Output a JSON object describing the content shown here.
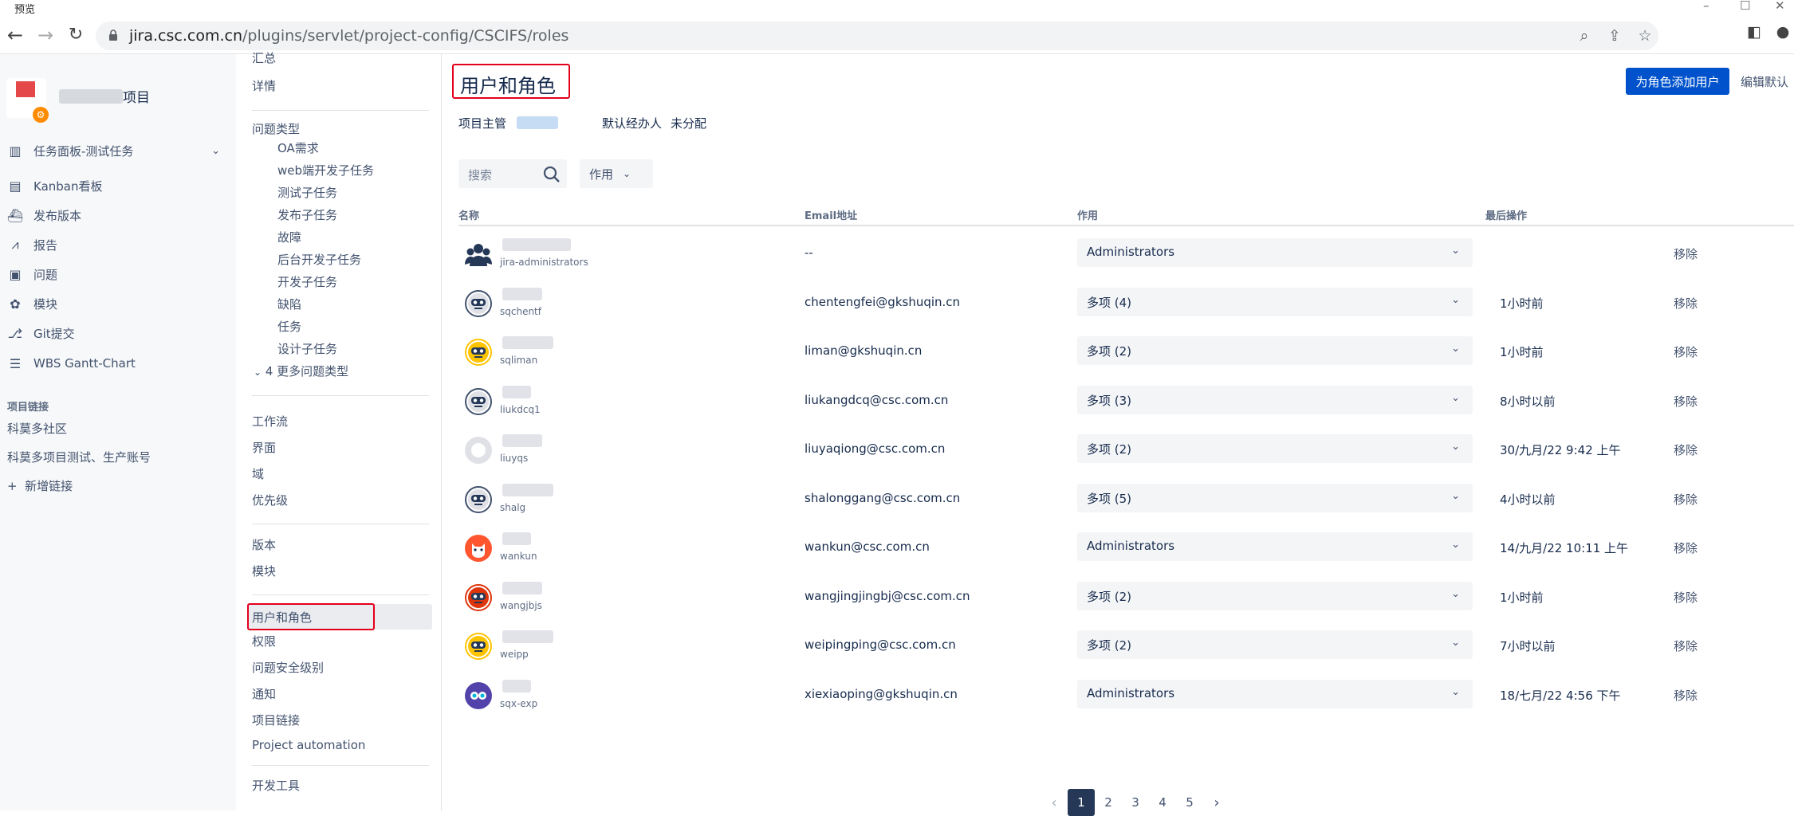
{
  "window": {
    "title": "预览"
  },
  "browser": {
    "url_host": "jira.csc.com.cn",
    "url_path": "/plugins/servlet/project-config/CSCIFS/roles"
  },
  "project_nav": {
    "project_name": "项目",
    "items": [
      {
        "label": "任务面板-测试任务",
        "icon": "board-icon",
        "has_chevron": true
      },
      {
        "label": "Kanban看板",
        "icon": "kanban-icon"
      },
      {
        "label": "发布版本",
        "icon": "ship-icon"
      },
      {
        "label": "报告",
        "icon": "chart-icon"
      },
      {
        "label": "问题",
        "icon": "issues-icon"
      },
      {
        "label": "模块",
        "icon": "puzzle-icon"
      },
      {
        "label": "Git提交",
        "icon": "git-icon"
      },
      {
        "label": "WBS Gantt-Chart",
        "icon": "gantt-icon"
      }
    ],
    "links_heading": "项目链接",
    "links": [
      "科莫多社区",
      "科莫多项目测试、生产账号"
    ],
    "add_link": "新增链接"
  },
  "settings_nav": {
    "summary": "汇总",
    "details": "详情",
    "issue_types": "问题类型",
    "issue_type_items": [
      "OA需求",
      "web端开发子任务",
      "测试子任务",
      "发布子任务",
      "故障",
      "后台开发子任务",
      "开发子任务",
      "缺陷",
      "任务",
      "设计子任务"
    ],
    "more_types": "4 更多问题类型",
    "group2": [
      "工作流",
      "界面",
      "域",
      "优先级"
    ],
    "group3": [
      "版本",
      "模块"
    ],
    "group4": [
      "用户和角色",
      "权限",
      "问题安全级别",
      "通知",
      "项目链接",
      "Project automation"
    ],
    "dev_tools": "开发工具"
  },
  "main": {
    "title": "用户和角色",
    "add_button": "为角色添加用户",
    "edit_button": "编辑默认",
    "lead_label": "项目主管",
    "assignee_label": "默认经办人",
    "assignee_value": "未分配",
    "search_placeholder": "搜索",
    "role_filter": "作用",
    "columns": {
      "name": "名称",
      "email": "Email地址",
      "role": "作用",
      "last": "最后操作"
    },
    "remove_label": "移除",
    "rows": [
      {
        "username": "jira-administrators",
        "email": "--",
        "role": "Administrators",
        "last": "",
        "avatar": "group-avatar-icon",
        "color": "#253858"
      },
      {
        "username": "sqchentf",
        "email": "chentengfei@gkshuqin.cn",
        "role": "多项 (4)",
        "last": "1小时前",
        "avatar": "robot-avatar-icon",
        "color": "#42526e"
      },
      {
        "username": "sqliman",
        "email": "liman@gkshuqin.cn",
        "role": "多项 (2)",
        "last": "1小时前",
        "avatar": "robot-avatar-icon",
        "color": "#ffc400"
      },
      {
        "username": "liukdcq1",
        "email": "liukangdcq@csc.com.cn",
        "role": "多项 (3)",
        "last": "8小时以前",
        "avatar": "robot-avatar-icon",
        "color": "#42526e"
      },
      {
        "username": "liuyqs",
        "email": "liuyaqiong@csc.com.cn",
        "role": "多项 (2)",
        "last": "30/九月/22 9:42 上午",
        "avatar": "default-avatar-icon",
        "color": "#dfe1e6"
      },
      {
        "username": "shalg",
        "email": "shalonggang@csc.com.cn",
        "role": "多项 (5)",
        "last": "4小时以前",
        "avatar": "robot-avatar-icon",
        "color": "#42526e"
      },
      {
        "username": "wankun",
        "email": "wankun@csc.com.cn",
        "role": "Administrators",
        "last": "14/九月/22 10:11 上午",
        "avatar": "fox-avatar-icon",
        "color": "#ff5630"
      },
      {
        "username": "wangjbjs",
        "email": "wangjingjingbj@csc.com.cn",
        "role": "多项 (2)",
        "last": "1小时前",
        "avatar": "robot-avatar-icon",
        "color": "#de350b"
      },
      {
        "username": "weipp",
        "email": "weipingping@csc.com.cn",
        "role": "多项 (2)",
        "last": "7小时以前",
        "avatar": "robot-avatar-icon",
        "color": "#ffc400"
      },
      {
        "username": "sqx-exp",
        "email": "xiexiaoping@gkshuqin.cn",
        "role": "Administrators",
        "last": "18/七月/22 4:56 下午",
        "avatar": "owl-avatar-icon",
        "color": "#5243aa"
      }
    ],
    "pagination": {
      "pages": [
        "1",
        "2",
        "3",
        "4",
        "5"
      ],
      "current": "1"
    }
  }
}
